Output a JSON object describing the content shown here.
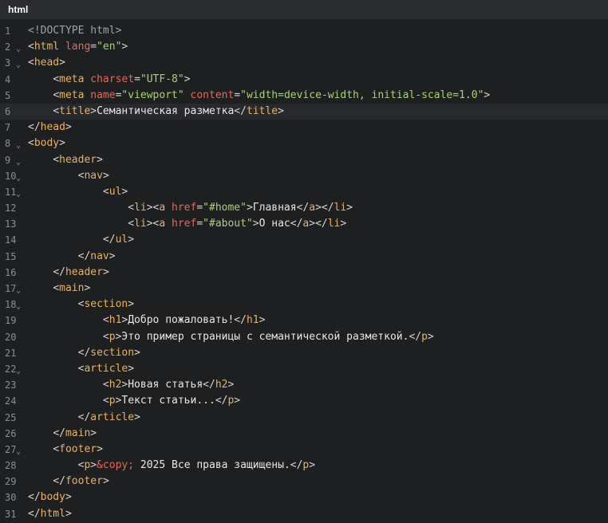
{
  "tab": {
    "title": "html"
  },
  "active_line": 6,
  "fold_icon": "chevron-down-icon",
  "fold_glyph": "⌄",
  "lines": [
    {
      "n": "1",
      "fold": false,
      "indent": "",
      "tokens": [
        [
          "doctype",
          "<!DOCTYPE html>"
        ]
      ]
    },
    {
      "n": "2",
      "fold": true,
      "indent": "",
      "tokens": [
        [
          "punct",
          "<"
        ],
        [
          "tag",
          "html"
        ],
        [
          "punct",
          " "
        ],
        [
          "attr",
          "lang"
        ],
        [
          "punct",
          "="
        ],
        [
          "str",
          "\"en\""
        ],
        [
          "punct",
          ">"
        ]
      ]
    },
    {
      "n": "3",
      "fold": true,
      "indent": "",
      "tokens": [
        [
          "punct",
          "<"
        ],
        [
          "tag",
          "head"
        ],
        [
          "punct",
          ">"
        ]
      ]
    },
    {
      "n": "4",
      "fold": false,
      "indent": "    ",
      "tokens": [
        [
          "punct",
          "<"
        ],
        [
          "tag",
          "meta"
        ],
        [
          "punct",
          " "
        ],
        [
          "attr",
          "charset"
        ],
        [
          "punct",
          "="
        ],
        [
          "str",
          "\"UTF-8\""
        ],
        [
          "punct",
          ">"
        ]
      ]
    },
    {
      "n": "5",
      "fold": false,
      "indent": "    ",
      "tokens": [
        [
          "punct",
          "<"
        ],
        [
          "tag",
          "meta"
        ],
        [
          "punct",
          " "
        ],
        [
          "attr",
          "name"
        ],
        [
          "punct",
          "="
        ],
        [
          "str",
          "\"viewport\""
        ],
        [
          "punct",
          " "
        ],
        [
          "attr",
          "content"
        ],
        [
          "punct",
          "="
        ],
        [
          "str",
          "\"width=device-width, initial-scale=1.0\""
        ],
        [
          "punct",
          ">"
        ]
      ]
    },
    {
      "n": "6",
      "fold": false,
      "indent": "    ",
      "tokens": [
        [
          "punct",
          "<"
        ],
        [
          "tag",
          "title"
        ],
        [
          "punct",
          ">"
        ],
        [
          "text",
          "Семантическая разметка"
        ],
        [
          "punct",
          "</"
        ],
        [
          "tag",
          "title"
        ],
        [
          "punct",
          ">"
        ]
      ]
    },
    {
      "n": "7",
      "fold": false,
      "indent": "",
      "tokens": [
        [
          "punct",
          "</"
        ],
        [
          "tag",
          "head"
        ],
        [
          "punct",
          ">"
        ]
      ]
    },
    {
      "n": "8",
      "fold": true,
      "indent": "",
      "tokens": [
        [
          "punct",
          "<"
        ],
        [
          "tag",
          "body"
        ],
        [
          "punct",
          ">"
        ]
      ]
    },
    {
      "n": "9",
      "fold": true,
      "indent": "    ",
      "tokens": [
        [
          "punct",
          "<"
        ],
        [
          "tag",
          "header"
        ],
        [
          "punct",
          ">"
        ]
      ]
    },
    {
      "n": "10",
      "fold": true,
      "indent": "        ",
      "tokens": [
        [
          "punct",
          "<"
        ],
        [
          "tag",
          "nav"
        ],
        [
          "punct",
          ">"
        ]
      ]
    },
    {
      "n": "11",
      "fold": true,
      "indent": "            ",
      "tokens": [
        [
          "punct",
          "<"
        ],
        [
          "tag",
          "ul"
        ],
        [
          "punct",
          ">"
        ]
      ]
    },
    {
      "n": "12",
      "fold": false,
      "indent": "                ",
      "tokens": [
        [
          "punct",
          "<"
        ],
        [
          "tag",
          "li"
        ],
        [
          "punct",
          "><"
        ],
        [
          "tag",
          "a"
        ],
        [
          "punct",
          " "
        ],
        [
          "attr",
          "href"
        ],
        [
          "punct",
          "="
        ],
        [
          "str",
          "\"#home\""
        ],
        [
          "punct",
          ">"
        ],
        [
          "text",
          "Главная"
        ],
        [
          "punct",
          "</"
        ],
        [
          "tag",
          "a"
        ],
        [
          "punct",
          "></"
        ],
        [
          "tag",
          "li"
        ],
        [
          "punct",
          ">"
        ]
      ]
    },
    {
      "n": "13",
      "fold": false,
      "indent": "                ",
      "tokens": [
        [
          "punct",
          "<"
        ],
        [
          "tag",
          "li"
        ],
        [
          "punct",
          "><"
        ],
        [
          "tag",
          "a"
        ],
        [
          "punct",
          " "
        ],
        [
          "attr",
          "href"
        ],
        [
          "punct",
          "="
        ],
        [
          "str",
          "\"#about\""
        ],
        [
          "punct",
          ">"
        ],
        [
          "text",
          "О нас"
        ],
        [
          "punct",
          "</"
        ],
        [
          "tag",
          "a"
        ],
        [
          "punct",
          "></"
        ],
        [
          "tag",
          "li"
        ],
        [
          "punct",
          ">"
        ]
      ]
    },
    {
      "n": "14",
      "fold": false,
      "indent": "            ",
      "tokens": [
        [
          "punct",
          "</"
        ],
        [
          "tag",
          "ul"
        ],
        [
          "punct",
          ">"
        ]
      ]
    },
    {
      "n": "15",
      "fold": false,
      "indent": "        ",
      "tokens": [
        [
          "punct",
          "</"
        ],
        [
          "tag",
          "nav"
        ],
        [
          "punct",
          ">"
        ]
      ]
    },
    {
      "n": "16",
      "fold": false,
      "indent": "    ",
      "tokens": [
        [
          "punct",
          "</"
        ],
        [
          "tag",
          "header"
        ],
        [
          "punct",
          ">"
        ]
      ]
    },
    {
      "n": "17",
      "fold": true,
      "indent": "    ",
      "tokens": [
        [
          "punct",
          "<"
        ],
        [
          "tag",
          "main"
        ],
        [
          "punct",
          ">"
        ]
      ]
    },
    {
      "n": "18",
      "fold": true,
      "indent": "        ",
      "tokens": [
        [
          "punct",
          "<"
        ],
        [
          "tag",
          "section"
        ],
        [
          "punct",
          ">"
        ]
      ]
    },
    {
      "n": "19",
      "fold": false,
      "indent": "            ",
      "tokens": [
        [
          "punct",
          "<"
        ],
        [
          "tag",
          "h1"
        ],
        [
          "punct",
          ">"
        ],
        [
          "text",
          "Добро пожаловать!"
        ],
        [
          "punct",
          "</"
        ],
        [
          "tag",
          "h1"
        ],
        [
          "punct",
          ">"
        ]
      ]
    },
    {
      "n": "20",
      "fold": false,
      "indent": "            ",
      "tokens": [
        [
          "punct",
          "<"
        ],
        [
          "tag",
          "p"
        ],
        [
          "punct",
          ">"
        ],
        [
          "text",
          "Это пример страницы с семантической разметкой."
        ],
        [
          "punct",
          "</"
        ],
        [
          "tag",
          "p"
        ],
        [
          "punct",
          ">"
        ]
      ]
    },
    {
      "n": "21",
      "fold": false,
      "indent": "        ",
      "tokens": [
        [
          "punct",
          "</"
        ],
        [
          "tag",
          "section"
        ],
        [
          "punct",
          ">"
        ]
      ]
    },
    {
      "n": "22",
      "fold": true,
      "indent": "        ",
      "tokens": [
        [
          "punct",
          "<"
        ],
        [
          "tag",
          "article"
        ],
        [
          "punct",
          ">"
        ]
      ]
    },
    {
      "n": "23",
      "fold": false,
      "indent": "            ",
      "tokens": [
        [
          "punct",
          "<"
        ],
        [
          "tag",
          "h2"
        ],
        [
          "punct",
          ">"
        ],
        [
          "text",
          "Новая статья"
        ],
        [
          "punct",
          "</"
        ],
        [
          "tag",
          "h2"
        ],
        [
          "punct",
          ">"
        ]
      ]
    },
    {
      "n": "24",
      "fold": false,
      "indent": "            ",
      "tokens": [
        [
          "punct",
          "<"
        ],
        [
          "tag",
          "p"
        ],
        [
          "punct",
          ">"
        ],
        [
          "text",
          "Текст статьи..."
        ],
        [
          "punct",
          "</"
        ],
        [
          "tag",
          "p"
        ],
        [
          "punct",
          ">"
        ]
      ]
    },
    {
      "n": "25",
      "fold": false,
      "indent": "        ",
      "tokens": [
        [
          "punct",
          "</"
        ],
        [
          "tag",
          "article"
        ],
        [
          "punct",
          ">"
        ]
      ]
    },
    {
      "n": "26",
      "fold": false,
      "indent": "    ",
      "tokens": [
        [
          "punct",
          "</"
        ],
        [
          "tag",
          "main"
        ],
        [
          "punct",
          ">"
        ]
      ]
    },
    {
      "n": "27",
      "fold": true,
      "indent": "    ",
      "tokens": [
        [
          "punct",
          "<"
        ],
        [
          "tag",
          "footer"
        ],
        [
          "punct",
          ">"
        ]
      ]
    },
    {
      "n": "28",
      "fold": false,
      "indent": "        ",
      "tokens": [
        [
          "punct",
          "<"
        ],
        [
          "tag",
          "p"
        ],
        [
          "punct",
          ">"
        ],
        [
          "entity",
          "&copy;"
        ],
        [
          "text",
          " 2025 Все права защищены."
        ],
        [
          "punct",
          "</"
        ],
        [
          "tag",
          "p"
        ],
        [
          "punct",
          ">"
        ]
      ]
    },
    {
      "n": "29",
      "fold": false,
      "indent": "    ",
      "tokens": [
        [
          "punct",
          "</"
        ],
        [
          "tag",
          "footer"
        ],
        [
          "punct",
          ">"
        ]
      ]
    },
    {
      "n": "30",
      "fold": false,
      "indent": "",
      "tokens": [
        [
          "punct",
          "</"
        ],
        [
          "tag",
          "body"
        ],
        [
          "punct",
          ">"
        ]
      ]
    },
    {
      "n": "31",
      "fold": false,
      "indent": "",
      "tokens": [
        [
          "punct",
          "</"
        ],
        [
          "tag",
          "html"
        ],
        [
          "punct",
          ">"
        ]
      ]
    }
  ]
}
